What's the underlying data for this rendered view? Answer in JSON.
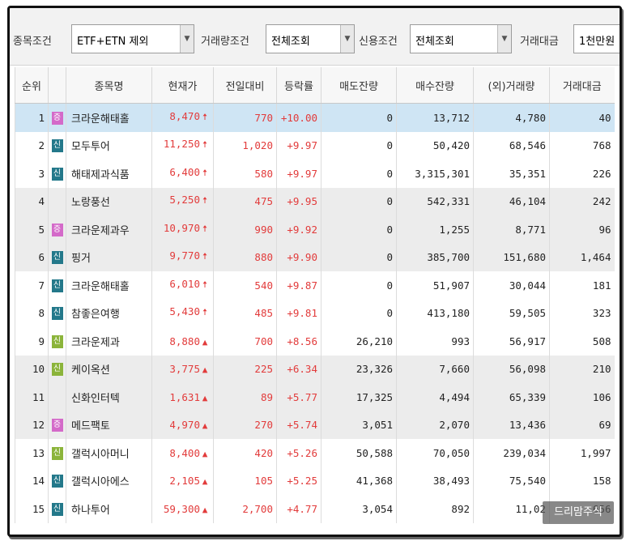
{
  "filters": {
    "stock_condition_label": "종목조건",
    "stock_condition_value": "ETF+ETN 제외",
    "volume_condition_label": "거래량조건",
    "volume_condition_value": "전체조회",
    "credit_condition_label": "신용조건",
    "credit_condition_value": "전체조회",
    "trade_amount_label": "거래대금",
    "trade_amount_value": "1천만원",
    "dropdown_glyph": "▼"
  },
  "table": {
    "headers": [
      "순위",
      "",
      "종목명",
      "현재가",
      "전일대비",
      "등락률",
      "매도잔량",
      "매수잔량",
      "(외)거래량",
      "거래대금"
    ],
    "rows": [
      {
        "rank": "1",
        "badge": "증",
        "badge_color": "pink",
        "name": "크라운해태홀",
        "price": "8,470",
        "dir": "up_limit",
        "arrow": "🠅",
        "change": "770",
        "rate": "+10.00",
        "ask": "0",
        "bid": "13,712",
        "volume": "4,780",
        "amount": "40"
      },
      {
        "rank": "2",
        "badge": "신",
        "badge_color": "teal",
        "name": "모두투어",
        "price": "11,250",
        "dir": "up_limit",
        "arrow": "🠅",
        "change": "1,020",
        "rate": "+9.97",
        "ask": "0",
        "bid": "50,420",
        "volume": "68,546",
        "amount": "768"
      },
      {
        "rank": "3",
        "badge": "신",
        "badge_color": "teal",
        "name": "해태제과식품",
        "price": "6,400",
        "dir": "up_limit",
        "arrow": "🠅",
        "change": "580",
        "rate": "+9.97",
        "ask": "0",
        "bid": "3,315,301",
        "volume": "35,351",
        "amount": "226"
      },
      {
        "rank": "4",
        "badge": "",
        "badge_color": "",
        "name": "노랑풍선",
        "price": "5,250",
        "dir": "up_limit",
        "arrow": "🠅",
        "change": "475",
        "rate": "+9.95",
        "ask": "0",
        "bid": "542,331",
        "volume": "46,104",
        "amount": "242"
      },
      {
        "rank": "5",
        "badge": "증",
        "badge_color": "pink",
        "name": "크라운제과우",
        "price": "10,970",
        "dir": "up_limit",
        "arrow": "🠅",
        "change": "990",
        "rate": "+9.92",
        "ask": "0",
        "bid": "1,255",
        "volume": "8,771",
        "amount": "96"
      },
      {
        "rank": "6",
        "badge": "신",
        "badge_color": "teal",
        "name": "핑거",
        "price": "9,770",
        "dir": "up_limit",
        "arrow": "🠅",
        "change": "880",
        "rate": "+9.90",
        "ask": "0",
        "bid": "385,700",
        "volume": "151,680",
        "amount": "1,464"
      },
      {
        "rank": "7",
        "badge": "신",
        "badge_color": "teal",
        "name": "크라운해태홀",
        "price": "6,010",
        "dir": "up_limit",
        "arrow": "🠅",
        "change": "540",
        "rate": "+9.87",
        "ask": "0",
        "bid": "51,907",
        "volume": "30,044",
        "amount": "181"
      },
      {
        "rank": "8",
        "badge": "신",
        "badge_color": "teal",
        "name": "참좋은여행",
        "price": "5,430",
        "dir": "up_limit",
        "arrow": "🠅",
        "change": "485",
        "rate": "+9.81",
        "ask": "0",
        "bid": "413,180",
        "volume": "59,505",
        "amount": "323"
      },
      {
        "rank": "9",
        "badge": "신",
        "badge_color": "olive",
        "name": "크라운제과",
        "price": "8,880",
        "dir": "up",
        "arrow": "▲",
        "change": "700",
        "rate": "+8.56",
        "ask": "26,210",
        "bid": "993",
        "volume": "56,917",
        "amount": "508"
      },
      {
        "rank": "10",
        "badge": "신",
        "badge_color": "olive",
        "name": "케이옥션",
        "price": "3,775",
        "dir": "up",
        "arrow": "▲",
        "change": "225",
        "rate": "+6.34",
        "ask": "23,326",
        "bid": "7,660",
        "volume": "56,098",
        "amount": "210"
      },
      {
        "rank": "11",
        "badge": "",
        "badge_color": "",
        "name": "신화인터텍",
        "price": "1,631",
        "dir": "up",
        "arrow": "▲",
        "change": "89",
        "rate": "+5.77",
        "ask": "17,325",
        "bid": "4,494",
        "volume": "65,339",
        "amount": "106"
      },
      {
        "rank": "12",
        "badge": "증",
        "badge_color": "pink",
        "name": "메드팩토",
        "price": "4,970",
        "dir": "up",
        "arrow": "▲",
        "change": "270",
        "rate": "+5.74",
        "ask": "3,051",
        "bid": "2,070",
        "volume": "13,436",
        "amount": "69"
      },
      {
        "rank": "13",
        "badge": "신",
        "badge_color": "olive",
        "name": "갤럭시아머니",
        "price": "8,400",
        "dir": "up",
        "arrow": "▲",
        "change": "420",
        "rate": "+5.26",
        "ask": "50,588",
        "bid": "70,050",
        "volume": "239,034",
        "amount": "1,997"
      },
      {
        "rank": "14",
        "badge": "신",
        "badge_color": "teal",
        "name": "갤럭시아에스",
        "price": "2,105",
        "dir": "up",
        "arrow": "▲",
        "change": "105",
        "rate": "+5.25",
        "ask": "41,368",
        "bid": "38,493",
        "volume": "75,540",
        "amount": "158"
      },
      {
        "rank": "15",
        "badge": "신",
        "badge_color": "teal",
        "name": "하나투어",
        "price": "59,300",
        "dir": "up",
        "arrow": "▲",
        "change": "2,700",
        "rate": "+4.77",
        "ask": "3,054",
        "bid": "892",
        "volume": "11,02",
        "amount": "656"
      }
    ]
  },
  "watermark": "드리맘주식",
  "colors": {
    "up": "#e23b3b",
    "selected_row": "#cfe5f4",
    "badge_pink": "#d46ac9",
    "badge_teal": "#23788a",
    "badge_olive": "#8bb43a"
  }
}
